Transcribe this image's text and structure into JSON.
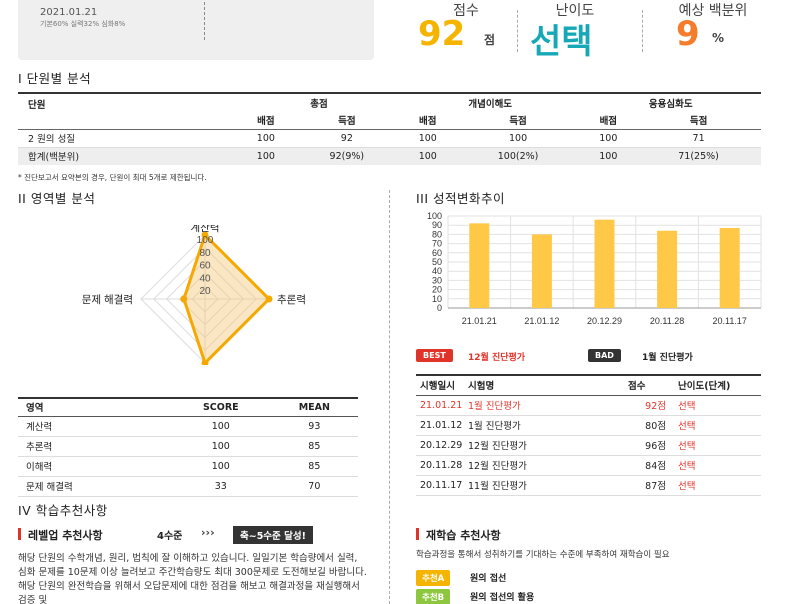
{
  "student_card": {
    "date": "2021.01.21",
    "sub": "기본60% 실력32% 심화8%"
  },
  "summary": {
    "score_label": "점수",
    "score_value": "92",
    "score_unit": "점",
    "difficulty_label": "난이도",
    "difficulty_value": "선택",
    "percentile_label": "예상 백분위",
    "percentile_value": "9",
    "percentile_unit": "%"
  },
  "section1": {
    "title": "I 단원별 분석",
    "col_unit": "단원",
    "groups": [
      "총점",
      "개념이해도",
      "응용심화도"
    ],
    "sub_headers": [
      "배점",
      "득점",
      "배점",
      "득점",
      "배점",
      "득점"
    ],
    "rows": [
      {
        "name": "2 원의 성질",
        "cells": [
          "100",
          "92",
          "100",
          "100",
          "100",
          "71"
        ]
      },
      {
        "name": "합계(백분위)",
        "cells": [
          "100",
          "92(9%)",
          "100",
          "100(2%)",
          "100",
          "71(25%)"
        ]
      }
    ],
    "note": "* 진단보고서 요약본의 경우, 단원이 최대 5개로 제한됩니다."
  },
  "section2": {
    "title": "II 영역별 분석",
    "axis_labels": [
      "계산력",
      "추론력",
      "이해력",
      "문제 해결력"
    ],
    "radial_ticks": [
      "100",
      "80",
      "60",
      "40",
      "20"
    ],
    "table_headers": [
      "영역",
      "SCORE",
      "MEAN"
    ],
    "rows": [
      {
        "area": "계산력",
        "score": "100",
        "mean": "93"
      },
      {
        "area": "추론력",
        "score": "100",
        "mean": "85"
      },
      {
        "area": "이해력",
        "score": "100",
        "mean": "85"
      },
      {
        "area": "문제 해결력",
        "score": "33",
        "mean": "70"
      }
    ]
  },
  "section3": {
    "title": "III 성적변화추이",
    "best_badge": "BEST",
    "best_text": "12월 진단평가",
    "bad_badge": "BAD",
    "bad_text": "1월 진단평가",
    "table_headers": [
      "시행일시",
      "시험명",
      "점수",
      "난이도(단계)"
    ],
    "rows": [
      {
        "date": "21.01.21",
        "name": "1월 진단평가",
        "score": "92점",
        "level": "선택",
        "highlight": true
      },
      {
        "date": "21.01.12",
        "name": "1월 진단평가",
        "score": "80점",
        "level": "선택",
        "highlight": false
      },
      {
        "date": "20.12.29",
        "name": "12월 진단평가",
        "score": "96점",
        "level": "선택",
        "highlight": false
      },
      {
        "date": "20.11.28",
        "name": "12월 진단평가",
        "score": "84점",
        "level": "선택",
        "highlight": false
      },
      {
        "date": "20.11.17",
        "name": "11월 진단평가",
        "score": "87점",
        "level": "선택",
        "highlight": false
      }
    ]
  },
  "section4": {
    "title": "IV 학습추천사항",
    "level_title": "레벨업 추천사항",
    "level_from": "4수준",
    "level_arrows": "›››",
    "level_goal": "축~5수준 달성!",
    "level_text": "해당 단원의 수학개념, 원리, 법칙에 잘 이해하고 있습니다. 일일기본 학습량에서 실력, 심화 문제를 10문제 이상 늘려보고 주간학습량도 최대 300문제로 도전해보길 바랍니다. 해당 단원의 완전학습을 위해서 오답문제에 대한 점검을 해보고 해결과정을 재실행해서 검증 및",
    "re_title": "재학습 추천사항",
    "re_text": "학습과정을 통해서 성취하기를 기대하는 수준에 부족하여 재학습이 필요",
    "recs": [
      {
        "tag": "추천A",
        "text": "원의 접선",
        "color": "#f5b400"
      },
      {
        "tag": "추천B",
        "text": "원의 접선의 활용",
        "color": "#8dc63f"
      }
    ]
  },
  "chart_data": [
    {
      "type": "bar",
      "categories": [
        "21.01.21",
        "21.01.12",
        "20.12.29",
        "20.11.28",
        "20.11.17"
      ],
      "values": [
        92,
        80,
        96,
        84,
        87
      ],
      "ylim": [
        0,
        100
      ],
      "yticks": [
        0,
        10,
        20,
        30,
        40,
        50,
        60,
        70,
        80,
        90,
        100
      ],
      "grid": true,
      "color": "#ffc846"
    },
    {
      "type": "radar",
      "axes": [
        "계산력",
        "추론력",
        "이해력",
        "문제 해결력"
      ],
      "values": [
        100,
        100,
        100,
        33
      ],
      "rlim": [
        0,
        100
      ],
      "color": "#f5a800"
    }
  ]
}
